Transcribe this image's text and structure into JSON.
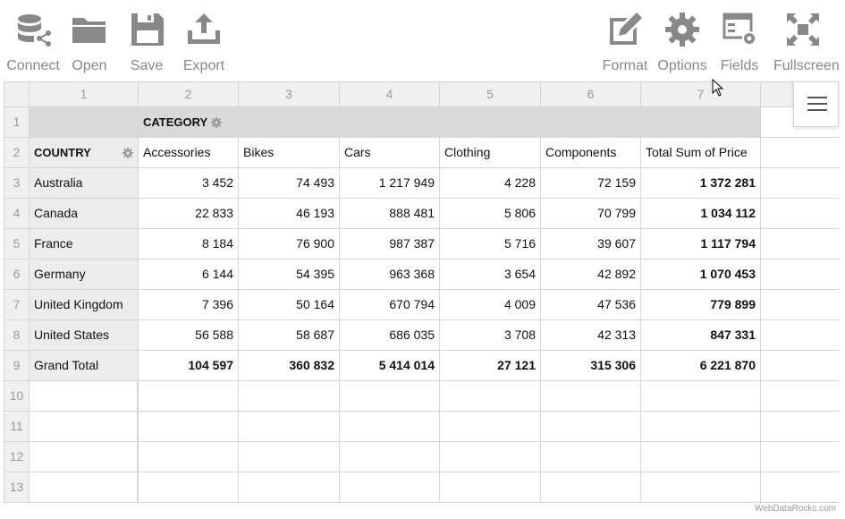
{
  "toolbar": {
    "left": [
      {
        "label": "Connect",
        "icon": "database-connect-icon"
      },
      {
        "label": "Open",
        "icon": "folder-icon"
      },
      {
        "label": "Save",
        "icon": "floppy-disk-icon"
      },
      {
        "label": "Export",
        "icon": "export-icon"
      }
    ],
    "right": [
      {
        "label": "Format",
        "icon": "format-pencil-icon"
      },
      {
        "label": "Options",
        "icon": "gear-icon"
      },
      {
        "label": "Fields",
        "icon": "fields-icon"
      },
      {
        "label": "Fullscreen",
        "icon": "fullscreen-icon"
      }
    ]
  },
  "grid": {
    "column_headers": [
      "1",
      "2",
      "3",
      "4",
      "5",
      "6",
      "7"
    ],
    "row_headers": [
      "1",
      "2",
      "3",
      "4",
      "5",
      "6",
      "7",
      "8",
      "9",
      "10",
      "11",
      "12",
      "13"
    ],
    "category_label": "CATEGORY",
    "country_label": "COUNTRY",
    "categories": [
      "Accessories",
      "Bikes",
      "Cars",
      "Clothing",
      "Components",
      "Total Sum of Price"
    ],
    "rows": [
      {
        "country": "Australia",
        "values": [
          "3 452",
          "74 493",
          "1 217 949",
          "4 228",
          "72 159",
          "1 372 281"
        ]
      },
      {
        "country": "Canada",
        "values": [
          "22 833",
          "46 193",
          "888 481",
          "5 806",
          "70 799",
          "1 034 112"
        ]
      },
      {
        "country": "France",
        "values": [
          "8 184",
          "76 900",
          "987 387",
          "5 716",
          "39 607",
          "1 117 794"
        ]
      },
      {
        "country": "Germany",
        "values": [
          "6 144",
          "54 395",
          "963 368",
          "3 654",
          "42 892",
          "1 070 453"
        ]
      },
      {
        "country": "United Kingdom",
        "values": [
          "7 396",
          "50 164",
          "670 794",
          "4 009",
          "47 536",
          "779 899"
        ]
      },
      {
        "country": "United States",
        "values": [
          "56 588",
          "58 687",
          "686 035",
          "3 708",
          "42 313",
          "847 331"
        ]
      }
    ],
    "grand_total": {
      "label": "Grand Total",
      "values": [
        "104 597",
        "360 832",
        "5 414 014",
        "27 121",
        "315 306",
        "6 221 870"
      ]
    }
  },
  "menu_icon": "hamburger-menu-icon",
  "watermark": "WebDataRocks.com",
  "colors": {
    "icon": "#888888",
    "header_bg": "#f0f0f0",
    "category_bar": "#d9d9d9",
    "border": "#d5d5d5"
  }
}
